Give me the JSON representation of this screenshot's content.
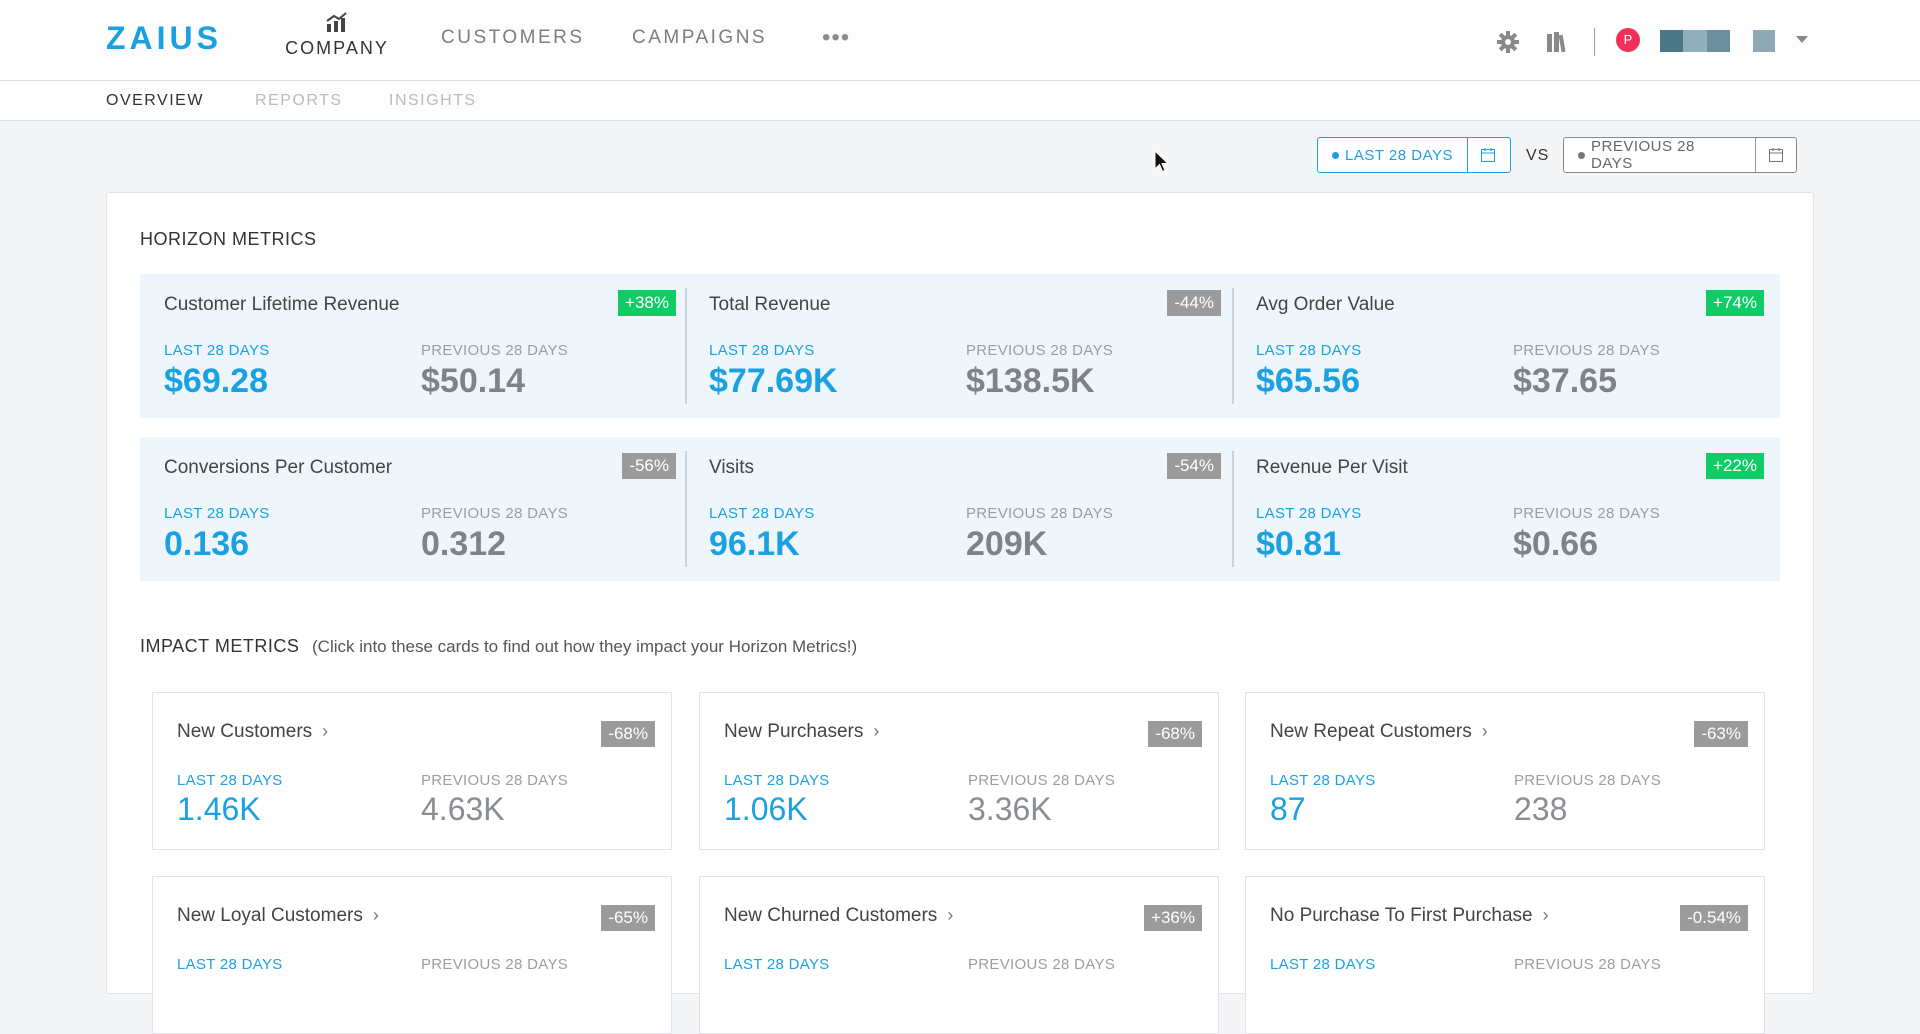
{
  "brand": {
    "name": "ZAIUS"
  },
  "colors": {
    "accent": "#1ba1e2",
    "positive": "#10cc67",
    "neutral": "#9b9b9b",
    "avatar": "#f0325a"
  },
  "nav": {
    "company_label": "COMPANY",
    "customers_label": "CUSTOMERS",
    "campaigns_label": "CAMPAIGNS",
    "more_label": "•••",
    "user_initial": "P"
  },
  "subnav": {
    "overview": "OVERVIEW",
    "reports": "REPORTS",
    "insights": "INSIGHTS"
  },
  "date_range": {
    "current": "LAST 28 DAYS",
    "vs": "VS",
    "previous": "PREVIOUS 28 DAYS"
  },
  "horizon": {
    "title": "HORIZON METRICS",
    "metrics": [
      {
        "name": "Customer Lifetime Revenue",
        "change": "+38%",
        "trend": "up",
        "cur_label": "LAST 28 DAYS",
        "prev_label": "PREVIOUS 28 DAYS",
        "cur": "$69.28",
        "prev": "$50.14"
      },
      {
        "name": "Total Revenue",
        "change": "-44%",
        "trend": "down",
        "cur_label": "LAST 28 DAYS",
        "prev_label": "PREVIOUS 28 DAYS",
        "cur": "$77.69K",
        "prev": "$138.5K"
      },
      {
        "name": "Avg Order Value",
        "change": "+74%",
        "trend": "up",
        "cur_label": "LAST 28 DAYS",
        "prev_label": "PREVIOUS 28 DAYS",
        "cur": "$65.56",
        "prev": "$37.65"
      },
      {
        "name": "Conversions Per Customer",
        "change": "-56%",
        "trend": "down",
        "cur_label": "LAST 28 DAYS",
        "prev_label": "PREVIOUS 28 DAYS",
        "cur": "0.136",
        "prev": "0.312"
      },
      {
        "name": "Visits",
        "change": "-54%",
        "trend": "down",
        "cur_label": "LAST 28 DAYS",
        "prev_label": "PREVIOUS 28 DAYS",
        "cur": "96.1K",
        "prev": "209K"
      },
      {
        "name": "Revenue Per Visit",
        "change": "+22%",
        "trend": "up",
        "cur_label": "LAST 28 DAYS",
        "prev_label": "PREVIOUS 28 DAYS",
        "cur": "$0.81",
        "prev": "$0.66"
      }
    ]
  },
  "impact": {
    "title": "IMPACT METRICS",
    "hint": "(Click into these cards to find out how they impact your Horizon Metrics!)",
    "metrics": [
      {
        "name": "New Customers",
        "change": "-68%",
        "trend": "down",
        "cur_label": "LAST 28 DAYS",
        "prev_label": "PREVIOUS 28 DAYS",
        "cur": "1.46K",
        "prev": "4.63K"
      },
      {
        "name": "New Purchasers",
        "change": "-68%",
        "trend": "down",
        "cur_label": "LAST 28 DAYS",
        "prev_label": "PREVIOUS 28 DAYS",
        "cur": "1.06K",
        "prev": "3.36K"
      },
      {
        "name": "New Repeat Customers",
        "change": "-63%",
        "trend": "down",
        "cur_label": "LAST 28 DAYS",
        "prev_label": "PREVIOUS 28 DAYS",
        "cur": "87",
        "prev": "238"
      },
      {
        "name": "New Loyal Customers",
        "change": "-65%",
        "trend": "down",
        "cur_label": "LAST 28 DAYS",
        "prev_label": "PREVIOUS 28 DAYS",
        "cur": "",
        "prev": ""
      },
      {
        "name": "New Churned Customers",
        "change": "+36%",
        "trend": "down",
        "cur_label": "LAST 28 DAYS",
        "prev_label": "PREVIOUS 28 DAYS",
        "cur": "",
        "prev": ""
      },
      {
        "name": "No Purchase To First Purchase",
        "change": "-0.54%",
        "trend": "down",
        "cur_label": "LAST 28 DAYS",
        "prev_label": "PREVIOUS 28 DAYS",
        "cur": "",
        "prev": ""
      }
    ]
  }
}
